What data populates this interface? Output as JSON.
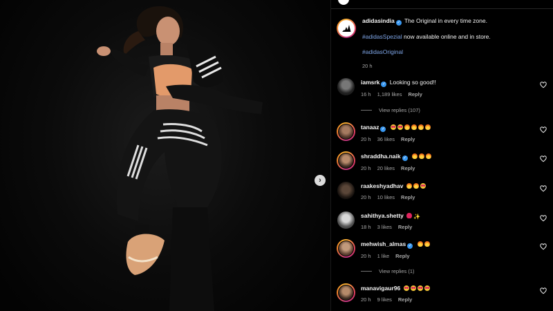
{
  "post": {
    "author": "adidasindia",
    "caption_line1": "The Original in every time zone.",
    "hashtag_spezial": "#adidasSpezial",
    "caption_line2_rest": " now available online and in store.",
    "hashtag_original": "#adidasOriginal",
    "time": "20 h"
  },
  "comments": [
    {
      "user": "iamsrk",
      "verified": true,
      "text": "Looking so good!!",
      "emoji": [],
      "time": "16 h",
      "likes": "1,189 likes",
      "reply": "Reply",
      "view_replies": "View replies (107)"
    },
    {
      "user": "tanaaz",
      "verified": true,
      "text": "",
      "emoji": [
        "face",
        "face",
        "fire",
        "fire",
        "fire",
        "fire"
      ],
      "time": "20 h",
      "likes": "36 likes",
      "reply": "Reply"
    },
    {
      "user": "shraddha.naik",
      "verified": true,
      "text": "",
      "emoji": [
        "fire",
        "fire",
        "fire"
      ],
      "time": "20 h",
      "likes": "20 likes",
      "reply": "Reply"
    },
    {
      "user": "raakeshyadhav",
      "verified": false,
      "text": "",
      "emoji": [
        "fire",
        "fire",
        "face"
      ],
      "time": "20 h",
      "likes": "10 likes",
      "reply": "Reply"
    },
    {
      "user": "sahithya.shetty",
      "verified": false,
      "text": "",
      "emoji": [
        "heart",
        "spark"
      ],
      "time": "18 h",
      "likes": "3 likes",
      "reply": "Reply"
    },
    {
      "user": "mehwish_almas",
      "verified": true,
      "text": "",
      "emoji": [
        "fire",
        "fire"
      ],
      "time": "20 h",
      "likes": "1 like",
      "reply": "Reply",
      "view_replies": "View replies (1)"
    },
    {
      "user": "manavigaur96",
      "verified": false,
      "text": "",
      "emoji": [
        "face",
        "face",
        "face",
        "face"
      ],
      "time": "20 h",
      "likes": "9 likes",
      "reply": "Reply"
    }
  ],
  "colors": {
    "hashtag": "#7fa6e8",
    "verified": "#3897f0",
    "background": "#000000"
  },
  "icons": {
    "like": "heart-outline-icon",
    "next": "chevron-right-icon",
    "verified": "verified-badge-icon"
  }
}
